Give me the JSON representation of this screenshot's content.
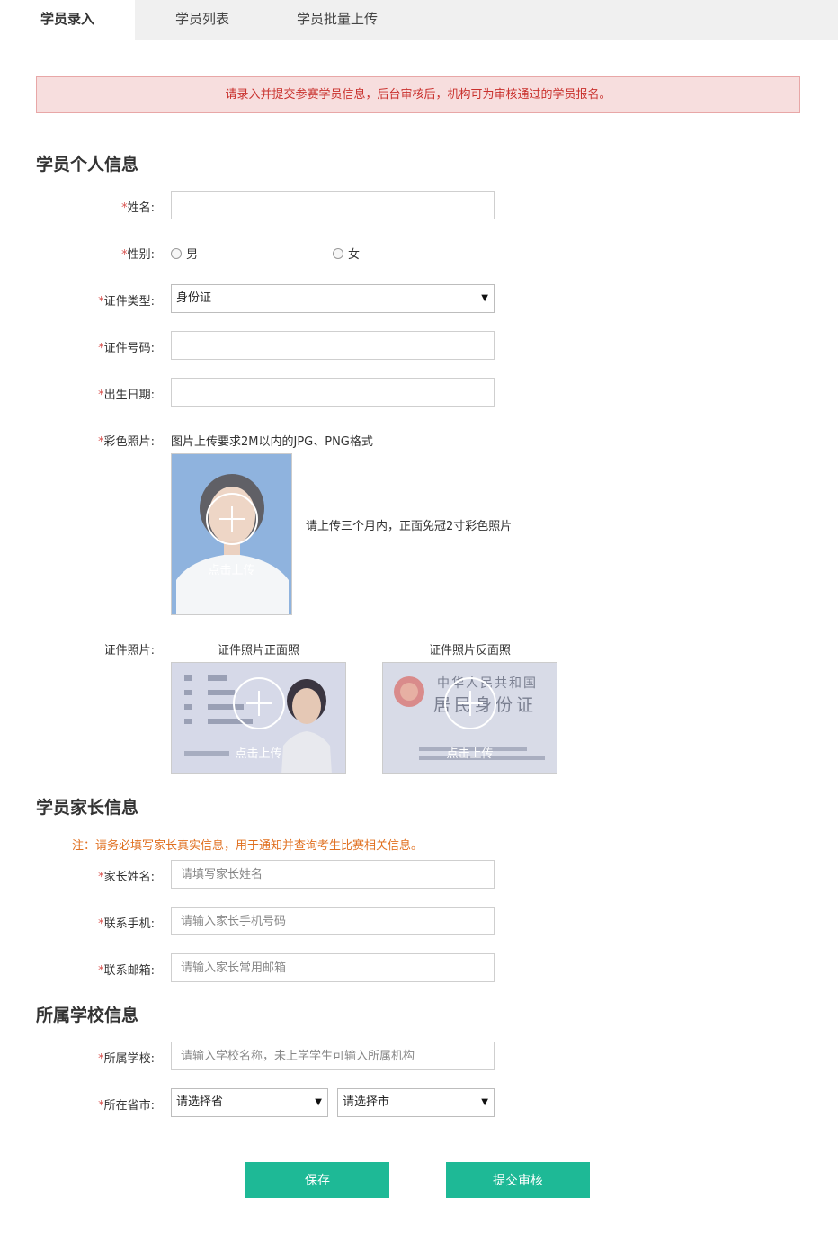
{
  "tabs": [
    {
      "label": "学员录入",
      "active": true
    },
    {
      "label": "学员列表",
      "active": false
    },
    {
      "label": "学员批量上传",
      "active": false
    }
  ],
  "notice": "请录入并提交参赛学员信息，后台审核后，机构可为审核通过的学员报名。",
  "personal": {
    "title": "学员个人信息",
    "name_label": "姓名:",
    "gender_label": "性别:",
    "gender_options": [
      "男",
      "女"
    ],
    "idtype_label": "证件类型:",
    "idtype_value": "身份证",
    "idnum_label": "证件号码:",
    "birth_label": "出生日期:",
    "photo_label": "彩色照片:",
    "photo_requirement": "图片上传要求2M以内的JPG、PNG格式",
    "photo_hint": "请上传三个月内，正面免冠2寸彩色照片",
    "upload_text": "点击上传",
    "idphoto_label": "证件照片:",
    "idphoto_front": "证件照片正面照",
    "idphoto_back": "证件照片反面照",
    "id_back_line1": "中华人民共和国",
    "id_back_line2": "居民身份证"
  },
  "parent": {
    "title": "学员家长信息",
    "note": "注：请务必填写家长真实信息，用于通知并查询考生比赛相关信息。",
    "name_label": "家长姓名:",
    "name_placeholder": "请填写家长姓名",
    "phone_label": "联系手机:",
    "phone_placeholder": "请输入家长手机号码",
    "email_label": "联系邮箱:",
    "email_placeholder": "请输入家长常用邮箱"
  },
  "school": {
    "title": "所属学校信息",
    "school_label": "所属学校:",
    "school_placeholder": "请输入学校名称，未上学学生可输入所属机构",
    "region_label": "所在省市:",
    "province_value": "请选择省",
    "city_value": "请选择市"
  },
  "actions": {
    "save": "保存",
    "submit": "提交审核"
  },
  "required_mark": "*",
  "colors": {
    "accent": "#1eb996",
    "notice_bg": "#f7dede",
    "notice_text": "#c9302c",
    "required": "#d9534f",
    "parent_note": "#e07020"
  },
  "icons": {
    "upload": "plus-circle-icon",
    "select_arrow": "caret-down-icon"
  }
}
